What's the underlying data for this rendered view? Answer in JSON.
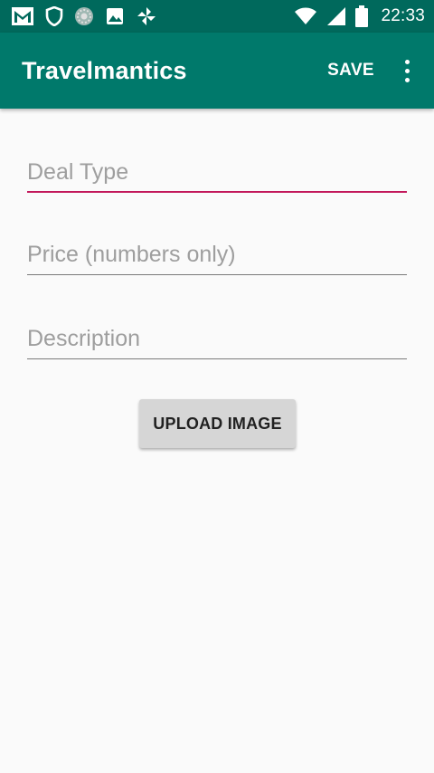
{
  "status_bar": {
    "time": "22:33",
    "icons": [
      "gmail-icon",
      "shield-icon",
      "sync-icon",
      "image-icon",
      "pinwheel-icon",
      "wifi-icon",
      "signal-icon",
      "battery-icon"
    ]
  },
  "app_bar": {
    "title": "Travelmantics",
    "save_label": "SAVE",
    "overflow_icon": "more-vert-icon"
  },
  "form": {
    "deal_type": {
      "value": "",
      "placeholder": "Deal Type"
    },
    "price": {
      "value": "",
      "placeholder": "Price (numbers only)"
    },
    "description": {
      "value": "",
      "placeholder": "Description"
    },
    "upload_label": "UPLOAD IMAGE"
  },
  "colors": {
    "status_bar": "#00695c",
    "app_bar": "#00796b",
    "accent": "#c2185b",
    "background": "#fafafa",
    "button": "#d6d6d6"
  }
}
